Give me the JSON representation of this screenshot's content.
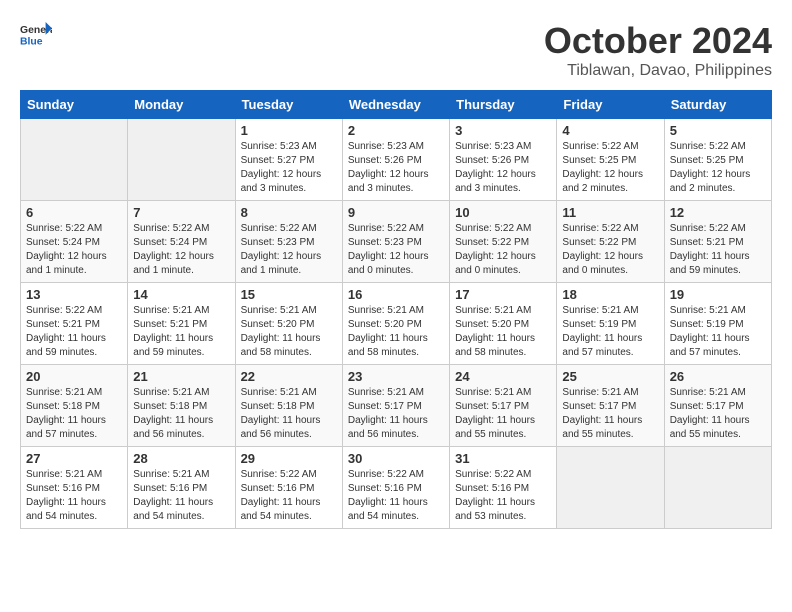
{
  "header": {
    "logo_line1": "General",
    "logo_line2": "Blue",
    "month_title": "October 2024",
    "subtitle": "Tiblawan, Davao, Philippines"
  },
  "weekdays": [
    "Sunday",
    "Monday",
    "Tuesday",
    "Wednesday",
    "Thursday",
    "Friday",
    "Saturday"
  ],
  "weeks": [
    [
      {
        "day": "",
        "sunrise": "",
        "sunset": "",
        "daylight": ""
      },
      {
        "day": "",
        "sunrise": "",
        "sunset": "",
        "daylight": ""
      },
      {
        "day": "1",
        "sunrise": "Sunrise: 5:23 AM",
        "sunset": "Sunset: 5:27 PM",
        "daylight": "Daylight: 12 hours and 3 minutes."
      },
      {
        "day": "2",
        "sunrise": "Sunrise: 5:23 AM",
        "sunset": "Sunset: 5:26 PM",
        "daylight": "Daylight: 12 hours and 3 minutes."
      },
      {
        "day": "3",
        "sunrise": "Sunrise: 5:23 AM",
        "sunset": "Sunset: 5:26 PM",
        "daylight": "Daylight: 12 hours and 3 minutes."
      },
      {
        "day": "4",
        "sunrise": "Sunrise: 5:22 AM",
        "sunset": "Sunset: 5:25 PM",
        "daylight": "Daylight: 12 hours and 2 minutes."
      },
      {
        "day": "5",
        "sunrise": "Sunrise: 5:22 AM",
        "sunset": "Sunset: 5:25 PM",
        "daylight": "Daylight: 12 hours and 2 minutes."
      }
    ],
    [
      {
        "day": "6",
        "sunrise": "Sunrise: 5:22 AM",
        "sunset": "Sunset: 5:24 PM",
        "daylight": "Daylight: 12 hours and 1 minute."
      },
      {
        "day": "7",
        "sunrise": "Sunrise: 5:22 AM",
        "sunset": "Sunset: 5:24 PM",
        "daylight": "Daylight: 12 hours and 1 minute."
      },
      {
        "day": "8",
        "sunrise": "Sunrise: 5:22 AM",
        "sunset": "Sunset: 5:23 PM",
        "daylight": "Daylight: 12 hours and 1 minute."
      },
      {
        "day": "9",
        "sunrise": "Sunrise: 5:22 AM",
        "sunset": "Sunset: 5:23 PM",
        "daylight": "Daylight: 12 hours and 0 minutes."
      },
      {
        "day": "10",
        "sunrise": "Sunrise: 5:22 AM",
        "sunset": "Sunset: 5:22 PM",
        "daylight": "Daylight: 12 hours and 0 minutes."
      },
      {
        "day": "11",
        "sunrise": "Sunrise: 5:22 AM",
        "sunset": "Sunset: 5:22 PM",
        "daylight": "Daylight: 12 hours and 0 minutes."
      },
      {
        "day": "12",
        "sunrise": "Sunrise: 5:22 AM",
        "sunset": "Sunset: 5:21 PM",
        "daylight": "Daylight: 11 hours and 59 minutes."
      }
    ],
    [
      {
        "day": "13",
        "sunrise": "Sunrise: 5:22 AM",
        "sunset": "Sunset: 5:21 PM",
        "daylight": "Daylight: 11 hours and 59 minutes."
      },
      {
        "day": "14",
        "sunrise": "Sunrise: 5:21 AM",
        "sunset": "Sunset: 5:21 PM",
        "daylight": "Daylight: 11 hours and 59 minutes."
      },
      {
        "day": "15",
        "sunrise": "Sunrise: 5:21 AM",
        "sunset": "Sunset: 5:20 PM",
        "daylight": "Daylight: 11 hours and 58 minutes."
      },
      {
        "day": "16",
        "sunrise": "Sunrise: 5:21 AM",
        "sunset": "Sunset: 5:20 PM",
        "daylight": "Daylight: 11 hours and 58 minutes."
      },
      {
        "day": "17",
        "sunrise": "Sunrise: 5:21 AM",
        "sunset": "Sunset: 5:20 PM",
        "daylight": "Daylight: 11 hours and 58 minutes."
      },
      {
        "day": "18",
        "sunrise": "Sunrise: 5:21 AM",
        "sunset": "Sunset: 5:19 PM",
        "daylight": "Daylight: 11 hours and 57 minutes."
      },
      {
        "day": "19",
        "sunrise": "Sunrise: 5:21 AM",
        "sunset": "Sunset: 5:19 PM",
        "daylight": "Daylight: 11 hours and 57 minutes."
      }
    ],
    [
      {
        "day": "20",
        "sunrise": "Sunrise: 5:21 AM",
        "sunset": "Sunset: 5:18 PM",
        "daylight": "Daylight: 11 hours and 57 minutes."
      },
      {
        "day": "21",
        "sunrise": "Sunrise: 5:21 AM",
        "sunset": "Sunset: 5:18 PM",
        "daylight": "Daylight: 11 hours and 56 minutes."
      },
      {
        "day": "22",
        "sunrise": "Sunrise: 5:21 AM",
        "sunset": "Sunset: 5:18 PM",
        "daylight": "Daylight: 11 hours and 56 minutes."
      },
      {
        "day": "23",
        "sunrise": "Sunrise: 5:21 AM",
        "sunset": "Sunset: 5:17 PM",
        "daylight": "Daylight: 11 hours and 56 minutes."
      },
      {
        "day": "24",
        "sunrise": "Sunrise: 5:21 AM",
        "sunset": "Sunset: 5:17 PM",
        "daylight": "Daylight: 11 hours and 55 minutes."
      },
      {
        "day": "25",
        "sunrise": "Sunrise: 5:21 AM",
        "sunset": "Sunset: 5:17 PM",
        "daylight": "Daylight: 11 hours and 55 minutes."
      },
      {
        "day": "26",
        "sunrise": "Sunrise: 5:21 AM",
        "sunset": "Sunset: 5:17 PM",
        "daylight": "Daylight: 11 hours and 55 minutes."
      }
    ],
    [
      {
        "day": "27",
        "sunrise": "Sunrise: 5:21 AM",
        "sunset": "Sunset: 5:16 PM",
        "daylight": "Daylight: 11 hours and 54 minutes."
      },
      {
        "day": "28",
        "sunrise": "Sunrise: 5:21 AM",
        "sunset": "Sunset: 5:16 PM",
        "daylight": "Daylight: 11 hours and 54 minutes."
      },
      {
        "day": "29",
        "sunrise": "Sunrise: 5:22 AM",
        "sunset": "Sunset: 5:16 PM",
        "daylight": "Daylight: 11 hours and 54 minutes."
      },
      {
        "day": "30",
        "sunrise": "Sunrise: 5:22 AM",
        "sunset": "Sunset: 5:16 PM",
        "daylight": "Daylight: 11 hours and 54 minutes."
      },
      {
        "day": "31",
        "sunrise": "Sunrise: 5:22 AM",
        "sunset": "Sunset: 5:16 PM",
        "daylight": "Daylight: 11 hours and 53 minutes."
      },
      {
        "day": "",
        "sunrise": "",
        "sunset": "",
        "daylight": ""
      },
      {
        "day": "",
        "sunrise": "",
        "sunset": "",
        "daylight": ""
      }
    ]
  ]
}
